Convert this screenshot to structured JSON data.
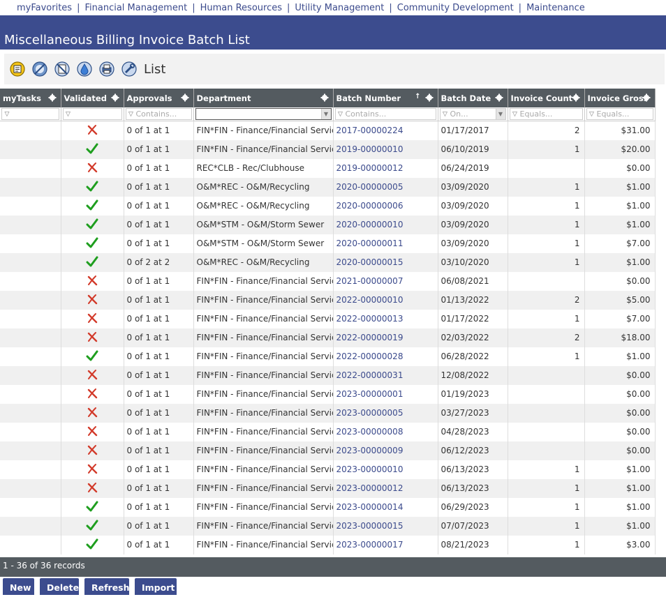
{
  "topnav": [
    "myFavorites",
    "Financial Management",
    "Human Resources",
    "Utility Management",
    "Community Development",
    "Maintenance"
  ],
  "page": {
    "title": "Miscellaneous Billing Invoice Batch List"
  },
  "toolbar": {
    "icons": [
      "invoice-summary-icon",
      "search-slash-icon",
      "disconnect-icon",
      "water-icon",
      "print-icon",
      "tools-icon"
    ],
    "label": "List"
  },
  "grid": {
    "columns": [
      {
        "label": "myTasks",
        "filter": ""
      },
      {
        "label": "Validated",
        "filter": ""
      },
      {
        "label": "Approvals",
        "filter": "Contains..."
      },
      {
        "label": "Department",
        "filter": ""
      },
      {
        "label": "Batch Number",
        "filter": "Contains...",
        "sorted": "asc"
      },
      {
        "label": "Batch Date",
        "filter": "On..."
      },
      {
        "label": "Invoice Count",
        "filter": "Equals..."
      },
      {
        "label": "Invoice Gross",
        "filter": "Equals..."
      }
    ],
    "colors": {
      "check": "#1e9e1e",
      "cross": "#d23a2a",
      "link": "#3b4a8c"
    },
    "rows": [
      {
        "valid": false,
        "approvals": "0 of 1 at 1",
        "dept": "FIN*FIN - Finance/Financial Services",
        "batch": "2017-00000224",
        "date": "01/17/2017",
        "count": "2",
        "gross": "$31.00"
      },
      {
        "valid": true,
        "approvals": "0 of 1 at 1",
        "dept": "FIN*FIN - Finance/Financial Services",
        "batch": "2019-00000010",
        "date": "06/10/2019",
        "count": "1",
        "gross": "$20.00"
      },
      {
        "valid": false,
        "approvals": "0 of 1 at 1",
        "dept": "REC*CLB - Rec/Clubhouse",
        "batch": "2019-00000012",
        "date": "06/24/2019",
        "count": "",
        "gross": "$0.00"
      },
      {
        "valid": true,
        "approvals": "0 of 1 at 1",
        "dept": "O&M*REC - O&M/Recycling",
        "batch": "2020-00000005",
        "date": "03/09/2020",
        "count": "1",
        "gross": "$1.00"
      },
      {
        "valid": true,
        "approvals": "0 of 1 at 1",
        "dept": "O&M*REC - O&M/Recycling",
        "batch": "2020-00000006",
        "date": "03/09/2020",
        "count": "1",
        "gross": "$1.00"
      },
      {
        "valid": true,
        "approvals": "0 of 1 at 1",
        "dept": "O&M*STM - O&M/Storm Sewer",
        "batch": "2020-00000010",
        "date": "03/09/2020",
        "count": "1",
        "gross": "$1.00"
      },
      {
        "valid": true,
        "approvals": "0 of 1 at 1",
        "dept": "O&M*STM - O&M/Storm Sewer",
        "batch": "2020-00000011",
        "date": "03/09/2020",
        "count": "1",
        "gross": "$7.00"
      },
      {
        "valid": true,
        "approvals": "0 of 2 at 2",
        "dept": "O&M*REC - O&M/Recycling",
        "batch": "2020-00000015",
        "date": "03/10/2020",
        "count": "1",
        "gross": "$1.00"
      },
      {
        "valid": false,
        "approvals": "0 of 1 at 1",
        "dept": "FIN*FIN - Finance/Financial Services",
        "batch": "2021-00000007",
        "date": "06/08/2021",
        "count": "",
        "gross": "$0.00"
      },
      {
        "valid": false,
        "approvals": "0 of 1 at 1",
        "dept": "FIN*FIN - Finance/Financial Services",
        "batch": "2022-00000010",
        "date": "01/13/2022",
        "count": "2",
        "gross": "$5.00"
      },
      {
        "valid": false,
        "approvals": "0 of 1 at 1",
        "dept": "FIN*FIN - Finance/Financial Services",
        "batch": "2022-00000013",
        "date": "01/17/2022",
        "count": "1",
        "gross": "$7.00"
      },
      {
        "valid": false,
        "approvals": "0 of 1 at 1",
        "dept": "FIN*FIN - Finance/Financial Services",
        "batch": "2022-00000019",
        "date": "02/03/2022",
        "count": "2",
        "gross": "$18.00"
      },
      {
        "valid": true,
        "approvals": "0 of 1 at 1",
        "dept": "FIN*FIN - Finance/Financial Services",
        "batch": "2022-00000028",
        "date": "06/28/2022",
        "count": "1",
        "gross": "$1.00"
      },
      {
        "valid": false,
        "approvals": "0 of 1 at 1",
        "dept": "FIN*FIN - Finance/Financial Services",
        "batch": "2022-00000031",
        "date": "12/08/2022",
        "count": "",
        "gross": "$0.00"
      },
      {
        "valid": false,
        "approvals": "0 of 1 at 1",
        "dept": "FIN*FIN - Finance/Financial Services",
        "batch": "2023-00000001",
        "date": "01/19/2023",
        "count": "",
        "gross": "$0.00"
      },
      {
        "valid": false,
        "approvals": "0 of 1 at 1",
        "dept": "FIN*FIN - Finance/Financial Services",
        "batch": "2023-00000005",
        "date": "03/27/2023",
        "count": "",
        "gross": "$0.00"
      },
      {
        "valid": false,
        "approvals": "0 of 1 at 1",
        "dept": "FIN*FIN - Finance/Financial Services",
        "batch": "2023-00000008",
        "date": "04/28/2023",
        "count": "",
        "gross": "$0.00"
      },
      {
        "valid": false,
        "approvals": "0 of 1 at 1",
        "dept": "FIN*FIN - Finance/Financial Services",
        "batch": "2023-00000009",
        "date": "06/12/2023",
        "count": "",
        "gross": "$0.00"
      },
      {
        "valid": false,
        "approvals": "0 of 1 at 1",
        "dept": "FIN*FIN - Finance/Financial Services",
        "batch": "2023-00000010",
        "date": "06/13/2023",
        "count": "1",
        "gross": "$1.00"
      },
      {
        "valid": false,
        "approvals": "0 of 1 at 1",
        "dept": "FIN*FIN - Finance/Financial Services",
        "batch": "2023-00000012",
        "date": "06/13/2023",
        "count": "1",
        "gross": "$1.00"
      },
      {
        "valid": true,
        "approvals": "0 of 1 at 1",
        "dept": "FIN*FIN - Finance/Financial Services",
        "batch": "2023-00000014",
        "date": "06/29/2023",
        "count": "1",
        "gross": "$1.00"
      },
      {
        "valid": true,
        "approvals": "0 of 1 at 1",
        "dept": "FIN*FIN - Finance/Financial Services",
        "batch": "2023-00000015",
        "date": "07/07/2023",
        "count": "1",
        "gross": "$1.00"
      },
      {
        "valid": true,
        "approvals": "0 of 1 at 1",
        "dept": "FIN*FIN - Finance/Financial Services",
        "batch": "2023-00000017",
        "date": "08/21/2023",
        "count": "1",
        "gross": "$3.00"
      }
    ]
  },
  "pager": {
    "text": "1 - 36 of 36 records"
  },
  "buttons": {
    "new": "New",
    "delete": "Delete",
    "refresh": "Refresh",
    "import": "Import"
  }
}
